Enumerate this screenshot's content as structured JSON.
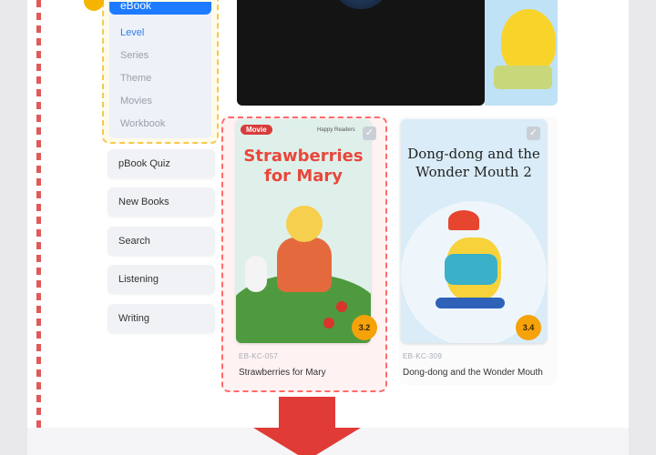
{
  "sidebar": {
    "section_label": "eBook",
    "sub_items": [
      "Level",
      "Series",
      "Theme",
      "Movies",
      "Workbook"
    ],
    "active_sub_item": "Level",
    "buttons": [
      "pBook Quiz",
      "New Books",
      "Search",
      "Listening",
      "Writing"
    ]
  },
  "books": [
    {
      "tag": "Movie",
      "publisher": "Happy Readers",
      "cover_title": "Strawberries for Mary",
      "level": "3.2",
      "code": "EB-KC-057",
      "title": "Strawberries for Mary"
    },
    {
      "cover_title": "Dong-dong and the Wonder Mouth 2",
      "level": "3.4",
      "code": "EB-KC-309",
      "title": "Dong-dong and the Wonder Mouth"
    }
  ],
  "icons": {
    "checkbox": "check-icon",
    "arrow": "arrow-down-icon"
  },
  "colors": {
    "accent": "#1e7bff",
    "highlight_dash": "#ff6b6b",
    "level_badge": "#f5a20b",
    "arrow": "#e03b36"
  }
}
